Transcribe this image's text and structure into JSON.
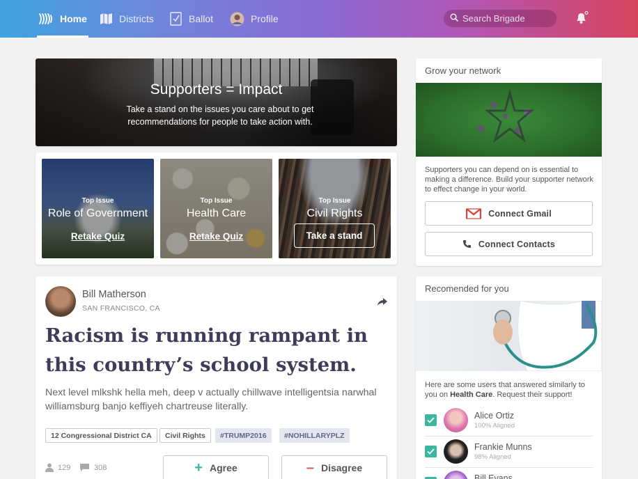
{
  "nav": {
    "items": [
      {
        "label": "Home",
        "icon": "waves-icon",
        "active": true
      },
      {
        "label": "Districts",
        "icon": "map-icon"
      },
      {
        "label": "Ballot",
        "icon": "checkbox-icon"
      },
      {
        "label": "Profile",
        "icon": "avatar"
      }
    ],
    "search_placeholder": "Search Brigade",
    "notification_icon": "bell-icon"
  },
  "hero": {
    "title": "Supporters = Impact",
    "subtitle": "Take a stand on the issues you care about to get recommendations for people to take action with."
  },
  "issues": [
    {
      "kicker": "Top Issue",
      "title": "Role of Government",
      "action": "Retake Quiz",
      "style": "link"
    },
    {
      "kicker": "Top Issue",
      "title": "Health Care",
      "action": "Retake Quiz",
      "style": "link"
    },
    {
      "kicker": "Top Issue",
      "title": "Civil Rights",
      "action": "Take a stand",
      "style": "button"
    }
  ],
  "post": {
    "author": "Bill Matherson",
    "location": "SAN FRANCISCO, CA",
    "headline": "Racism is running rampant in this country’s school system.",
    "body": "Next level mlkshk hella meh, deep v actually chillwave intelligentsia narwhal williamsburg banjo keffiyeh chartreuse literally.",
    "tags": [
      "12 Congressional District CA",
      "Civil Rights",
      "#TRUMP2016",
      "#NOHILLARYPLZ"
    ],
    "supporters_count": "129",
    "comments_count": "308",
    "agree_label": "Agree",
    "disagree_label": "Disagree"
  },
  "network": {
    "heading": "Grow your network",
    "text": "Supporters you can depend on is essential to making a difference. Build your supporter network to effect change in your world.",
    "gmail_label": "Connect Gmail",
    "contacts_label": "Connect Contacts"
  },
  "recommended": {
    "heading": "Recomended for you",
    "intro_before": "Here are some users that answered similarly to you on ",
    "intro_topic": "Health Care",
    "intro_after": ". Request their support!",
    "users": [
      {
        "name": "Alice Ortiz",
        "aligned": "100% Aligned"
      },
      {
        "name": "Frankie Munns",
        "aligned": "98% Aligned"
      },
      {
        "name": "Bill Evans",
        "aligned": ""
      }
    ]
  },
  "colors": {
    "accent_teal": "#3cb6a1",
    "agree_green": "#3cb6a1",
    "disagree_red": "#e1574c",
    "gmail_red": "#d44638"
  }
}
